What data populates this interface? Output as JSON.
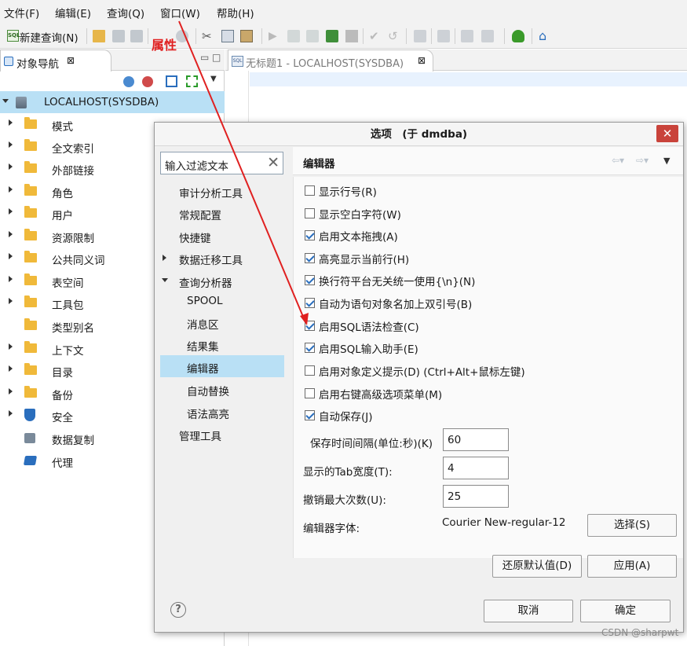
{
  "menu": [
    "文件(F)",
    "编辑(E)",
    "查询(Q)",
    "窗口(W)",
    "帮助(H)"
  ],
  "toolbar": {
    "new_query_label": "新建查询(N)"
  },
  "annotation": {
    "label": "属性",
    "color": "#e02020"
  },
  "nav": {
    "tab_title": "对象导航",
    "tab_close": "⊠",
    "root": "LOCALHOST(SYSDBA)",
    "items": [
      "模式",
      "全文索引",
      "外部链接",
      "角色",
      "用户",
      "资源限制",
      "公共同义词",
      "表空间",
      "工具包",
      "类型别名",
      "上下文",
      "目录",
      "备份",
      "安全",
      "数据复制",
      "代理"
    ]
  },
  "editor": {
    "tab_title": "无标题1 - LOCALHOST(SYSDBA)",
    "tab_close": "⊠"
  },
  "dialog": {
    "title": "选项　(于 dmdba)",
    "close": "✕",
    "filter_placeholder": "输入过滤文本",
    "filter_clear": "✕",
    "tree": [
      "审计分析工具",
      "常规配置",
      "快捷键",
      "数据迁移工具",
      "查询分析器",
      "SPOOL",
      "消息区",
      "结果集",
      "编辑器",
      "自动替换",
      "语法高亮",
      "管理工具"
    ],
    "page_title": "编辑器",
    "checkboxes": [
      {
        "label": "显示行号(R)",
        "checked": false
      },
      {
        "label": "显示空白字符(W)",
        "checked": false
      },
      {
        "label": "启用文本拖拽(A)",
        "checked": true
      },
      {
        "label": "高亮显示当前行(H)",
        "checked": true
      },
      {
        "label": "换行符平台无关统一使用{\\n}(N)",
        "checked": true
      },
      {
        "label": "自动为语句对象名加上双引号(B)",
        "checked": true
      },
      {
        "label": "启用SQL语法检查(C)",
        "checked": true
      },
      {
        "label": "启用SQL输入助手(E)",
        "checked": true
      },
      {
        "label": "启用对象定义提示(D) (Ctrl+Alt+鼠标左键)",
        "checked": false
      },
      {
        "label": "启用右键高级选项菜单(M)",
        "checked": false
      },
      {
        "label": "自动保存(J)",
        "checked": true
      }
    ],
    "fields": [
      {
        "label": "保存时间间隔(单位:秒)(K)",
        "value": "60"
      },
      {
        "label": "显示的Tab宽度(T):",
        "value": "4"
      },
      {
        "label": "撤销最大次数(U):",
        "value": "25"
      }
    ],
    "font_label": "编辑器字体:",
    "font_value": "Courier New-regular-12",
    "choose_button": "选择(S)",
    "restore_button": "还原默认值(D)",
    "apply_button": "应用(A)",
    "cancel_button": "取消",
    "ok_button": "确定",
    "help": "?"
  },
  "watermark": "CSDN @sharpwt"
}
